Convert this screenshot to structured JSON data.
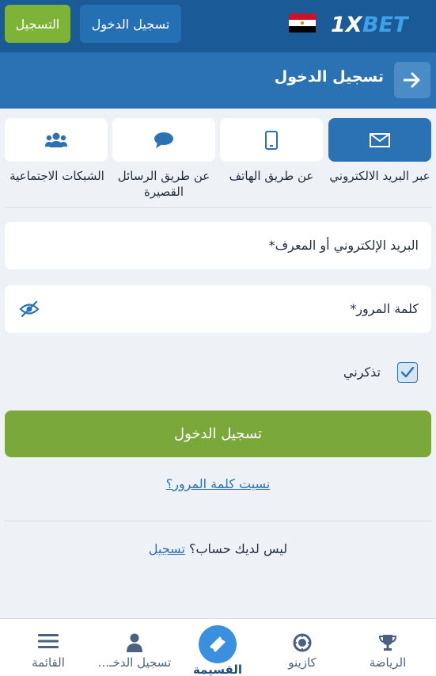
{
  "header": {
    "brand": "1XBET",
    "login_label": "تسجيل الدخول",
    "register_label": "التسجيل"
  },
  "titlebar": {
    "title": "تسجيل الدخول"
  },
  "methods": [
    {
      "label": "عبر البريد الالكتروني",
      "icon": "envelope-icon",
      "active": true
    },
    {
      "label": "عن طريق الهاتف",
      "icon": "phone-icon",
      "active": false
    },
    {
      "label": "عن طريق الرسائل القصيرة",
      "icon": "chat-icon",
      "active": false
    },
    {
      "label": "الشبكات الاجتماعية",
      "icon": "users-icon",
      "active": false
    }
  ],
  "form": {
    "email_placeholder": "البريد الإلكتروني أو المعرف*",
    "password_placeholder": "كلمة المرور*",
    "remember_label": "تذكرني",
    "remember_checked": true,
    "submit_label": "تسجيل الدخول",
    "forgot_label": "نسيت كلمة المرور؟",
    "no_account_text": "ليس لديك حساب؟",
    "register_link": "تسجيل"
  },
  "bottom_nav": {
    "sports": "الرياضة",
    "casino": "كازينو",
    "coupon": "القسيمة",
    "login": "تسجيل الدخـ...",
    "menu": "القائمة"
  },
  "colors": {
    "header_bg": "#1a5a96",
    "title_bg": "#2b72b4",
    "accent_green": "#7ba83a",
    "link_blue": "#2b72b4"
  }
}
